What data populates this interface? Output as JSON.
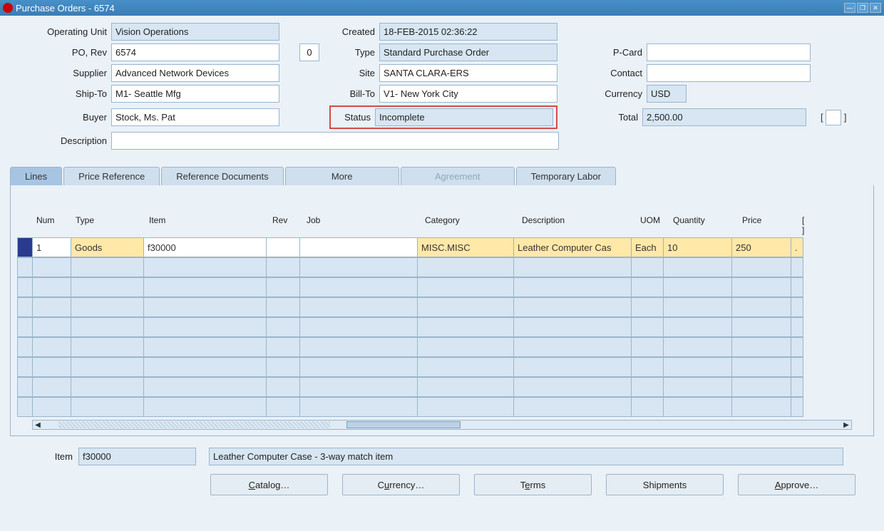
{
  "window": {
    "title": "Purchase Orders - 6574"
  },
  "header": {
    "labels": {
      "operating_unit": "Operating Unit",
      "po_rev": "PO, Rev",
      "supplier": "Supplier",
      "ship_to": "Ship-To",
      "buyer": "Buyer",
      "description": "Description",
      "created": "Created",
      "type": "Type",
      "site": "Site",
      "bill_to": "Bill-To",
      "status": "Status",
      "p_card": "P-Card",
      "contact": "Contact",
      "currency": "Currency",
      "total": "Total"
    },
    "values": {
      "operating_unit": "Vision Operations",
      "po": "6574",
      "rev": "0",
      "supplier": "Advanced Network Devices",
      "ship_to": "M1- Seattle Mfg",
      "buyer": "Stock, Ms. Pat",
      "description": "",
      "created": "18-FEB-2015 02:36:22",
      "type": "Standard Purchase Order",
      "site": "SANTA CLARA-ERS",
      "bill_to": "V1- New York City",
      "status": "Incomplete",
      "p_card": "",
      "contact": "",
      "currency": "USD",
      "total": "2,500.00",
      "total_checkbox": ""
    }
  },
  "tabs": {
    "lines": "Lines",
    "price_ref": "Price Reference",
    "ref_docs": "Reference Documents",
    "more": "More",
    "agreement": "Agreement",
    "temp_labor": "Temporary Labor"
  },
  "grid": {
    "headers": {
      "num": "Num",
      "type": "Type",
      "item": "Item",
      "rev": "Rev",
      "job": "Job",
      "category": "Category",
      "description": "Description",
      "uom": "UOM",
      "quantity": "Quantity",
      "price": "Price",
      "extra": ""
    },
    "rows": [
      {
        "num": "1",
        "type": "Goods",
        "item": "f30000",
        "rev": "",
        "job": "",
        "category": "MISC.MISC",
        "description": "Leather Computer Cas",
        "uom": "Each",
        "quantity": "10",
        "price": "250",
        "extra": "."
      },
      {},
      {},
      {},
      {},
      {},
      {},
      {},
      {}
    ]
  },
  "footer": {
    "item_label": "Item",
    "item_value": "f30000",
    "item_desc": "Leather Computer Case -  3-way match item"
  },
  "buttons": {
    "catalog": "Catalog…",
    "currency": "Currency…",
    "terms": "Terms",
    "shipments": "Shipments",
    "approve": "Approve…"
  }
}
